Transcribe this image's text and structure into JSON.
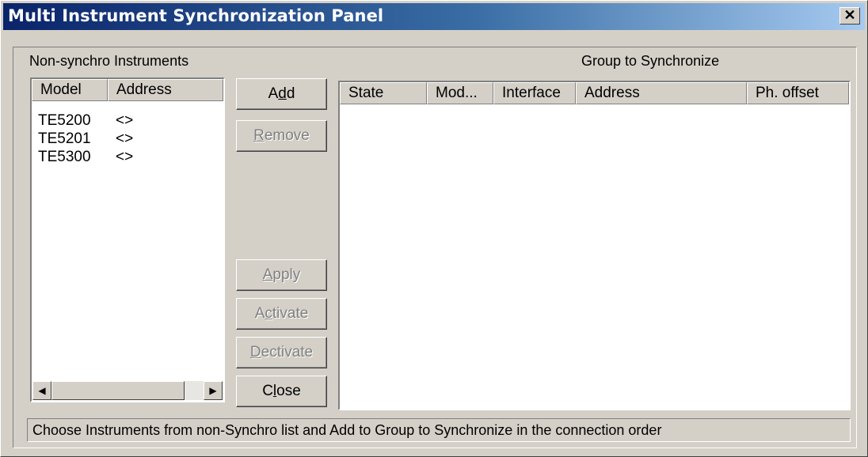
{
  "window": {
    "title": "Multi Instrument Synchronization Panel",
    "close_glyph": "✕"
  },
  "left_panel": {
    "label": "Non-synchro Instruments",
    "columns": [
      "Model",
      "Address"
    ],
    "rows": [
      {
        "model": "TE5200",
        "address": "<>"
      },
      {
        "model": "TE5201",
        "address": "<>"
      },
      {
        "model": "TE5300",
        "address": "<>"
      }
    ]
  },
  "right_panel": {
    "label": "Group to Synchronize",
    "columns": [
      "State",
      "Mod...",
      "Interface",
      "Address",
      "Ph. offset"
    ]
  },
  "buttons": {
    "add": {
      "pre": "A",
      "key": "d",
      "post": "d"
    },
    "remove": {
      "pre": "",
      "key": "R",
      "post": "emove"
    },
    "apply": {
      "pre": "",
      "key": "A",
      "post": "pply"
    },
    "activate": {
      "pre": "A",
      "key": "c",
      "post": "tivate"
    },
    "deactivate": {
      "pre": "",
      "key": "D",
      "post": "ectivate"
    },
    "close": {
      "pre": "C",
      "key": "l",
      "post": "ose"
    }
  },
  "scrollbar": {
    "left_arrow": "◀",
    "right_arrow": "▶"
  },
  "status": "Choose Instruments from non-Synchro list and Add to Group to Synchronize in  the  connection order"
}
